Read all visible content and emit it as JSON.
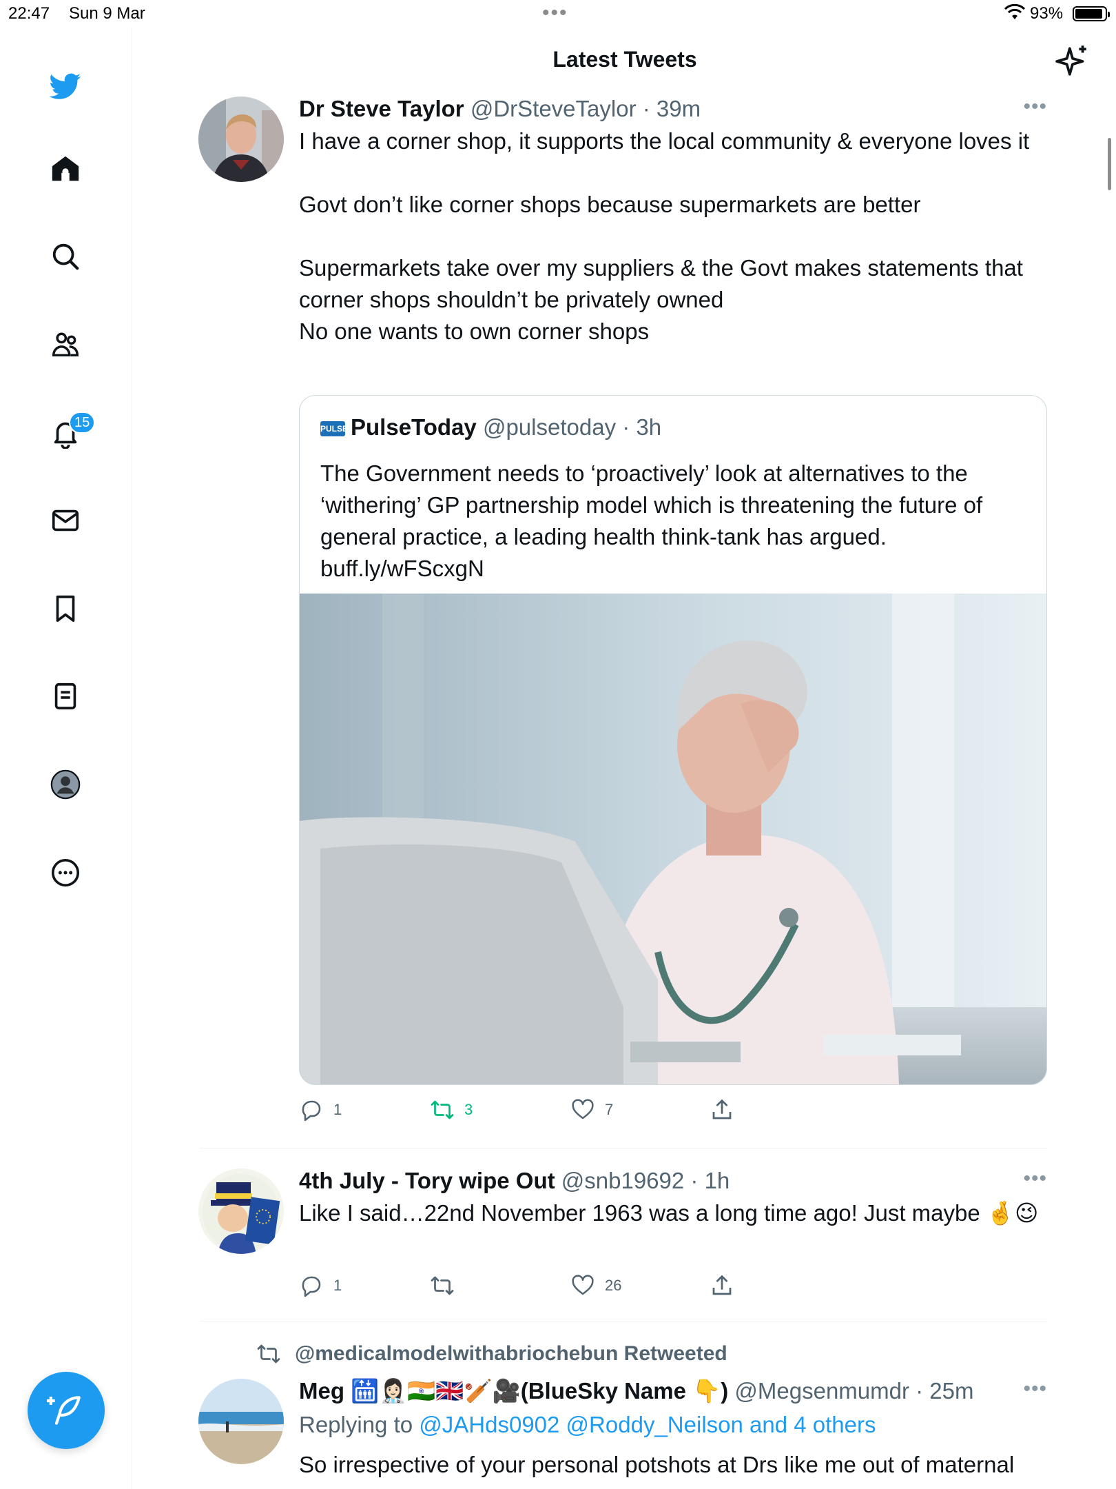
{
  "status_bar": {
    "time": "22:47",
    "date": "Sun 9 Mar",
    "battery": "93%"
  },
  "sidebar": {
    "notification_badge": "15"
  },
  "header": {
    "title": "Latest Tweets"
  },
  "tweets": [
    {
      "name": "Dr Steve Taylor",
      "handle": "@DrSteveTaylor",
      "time": "39m",
      "text": "I have a corner shop, it supports the local community & everyone loves it\n\nGovt don’t like corner shops because supermarkets are better\n\nSupermarkets take over my suppliers & the Govt makes statements that corner shops shouldn’t be privately owned\nNo one wants to own corner shops",
      "quote": {
        "logo": "PULSE",
        "name": "PulseToday",
        "handle": "@pulsetoday",
        "time": "3h",
        "text": "The Government needs to ‘proactively’ look at alternatives to the ‘withering’ GP partnership model which is threatening the future of general practice, a leading health think-tank has argued. buff.ly/wFScxgN"
      },
      "replies": "1",
      "retweets": "3",
      "likes": "7"
    },
    {
      "name": "4th July - Tory wipe Out",
      "handle": "@snb19692",
      "time": "1h",
      "text": "Like I said…22nd November 1963 was a long time ago! Just maybe 🤞😉",
      "replies": "1",
      "retweets": "",
      "likes": "26"
    },
    {
      "retweet_context": "@medicalmodelwithabriochebun Retweeted",
      "name": "Meg 🛗👩🏻‍⚕️🇮🇳🇬🇧🏏🎥(BlueSky Name 👇)",
      "handle": "@Megsenmumdr",
      "time": "25m",
      "replying_prefix": "Replying to",
      "replying_to": "@JAHds0902 @Roddy_Neilson and 4 others",
      "text": "So irrespective of your personal potshots at Drs like me out of maternal"
    }
  ],
  "colors": {
    "accent": "#1d9bf0",
    "retweet_active": "#00ba7c",
    "secondary_text": "#536471"
  }
}
